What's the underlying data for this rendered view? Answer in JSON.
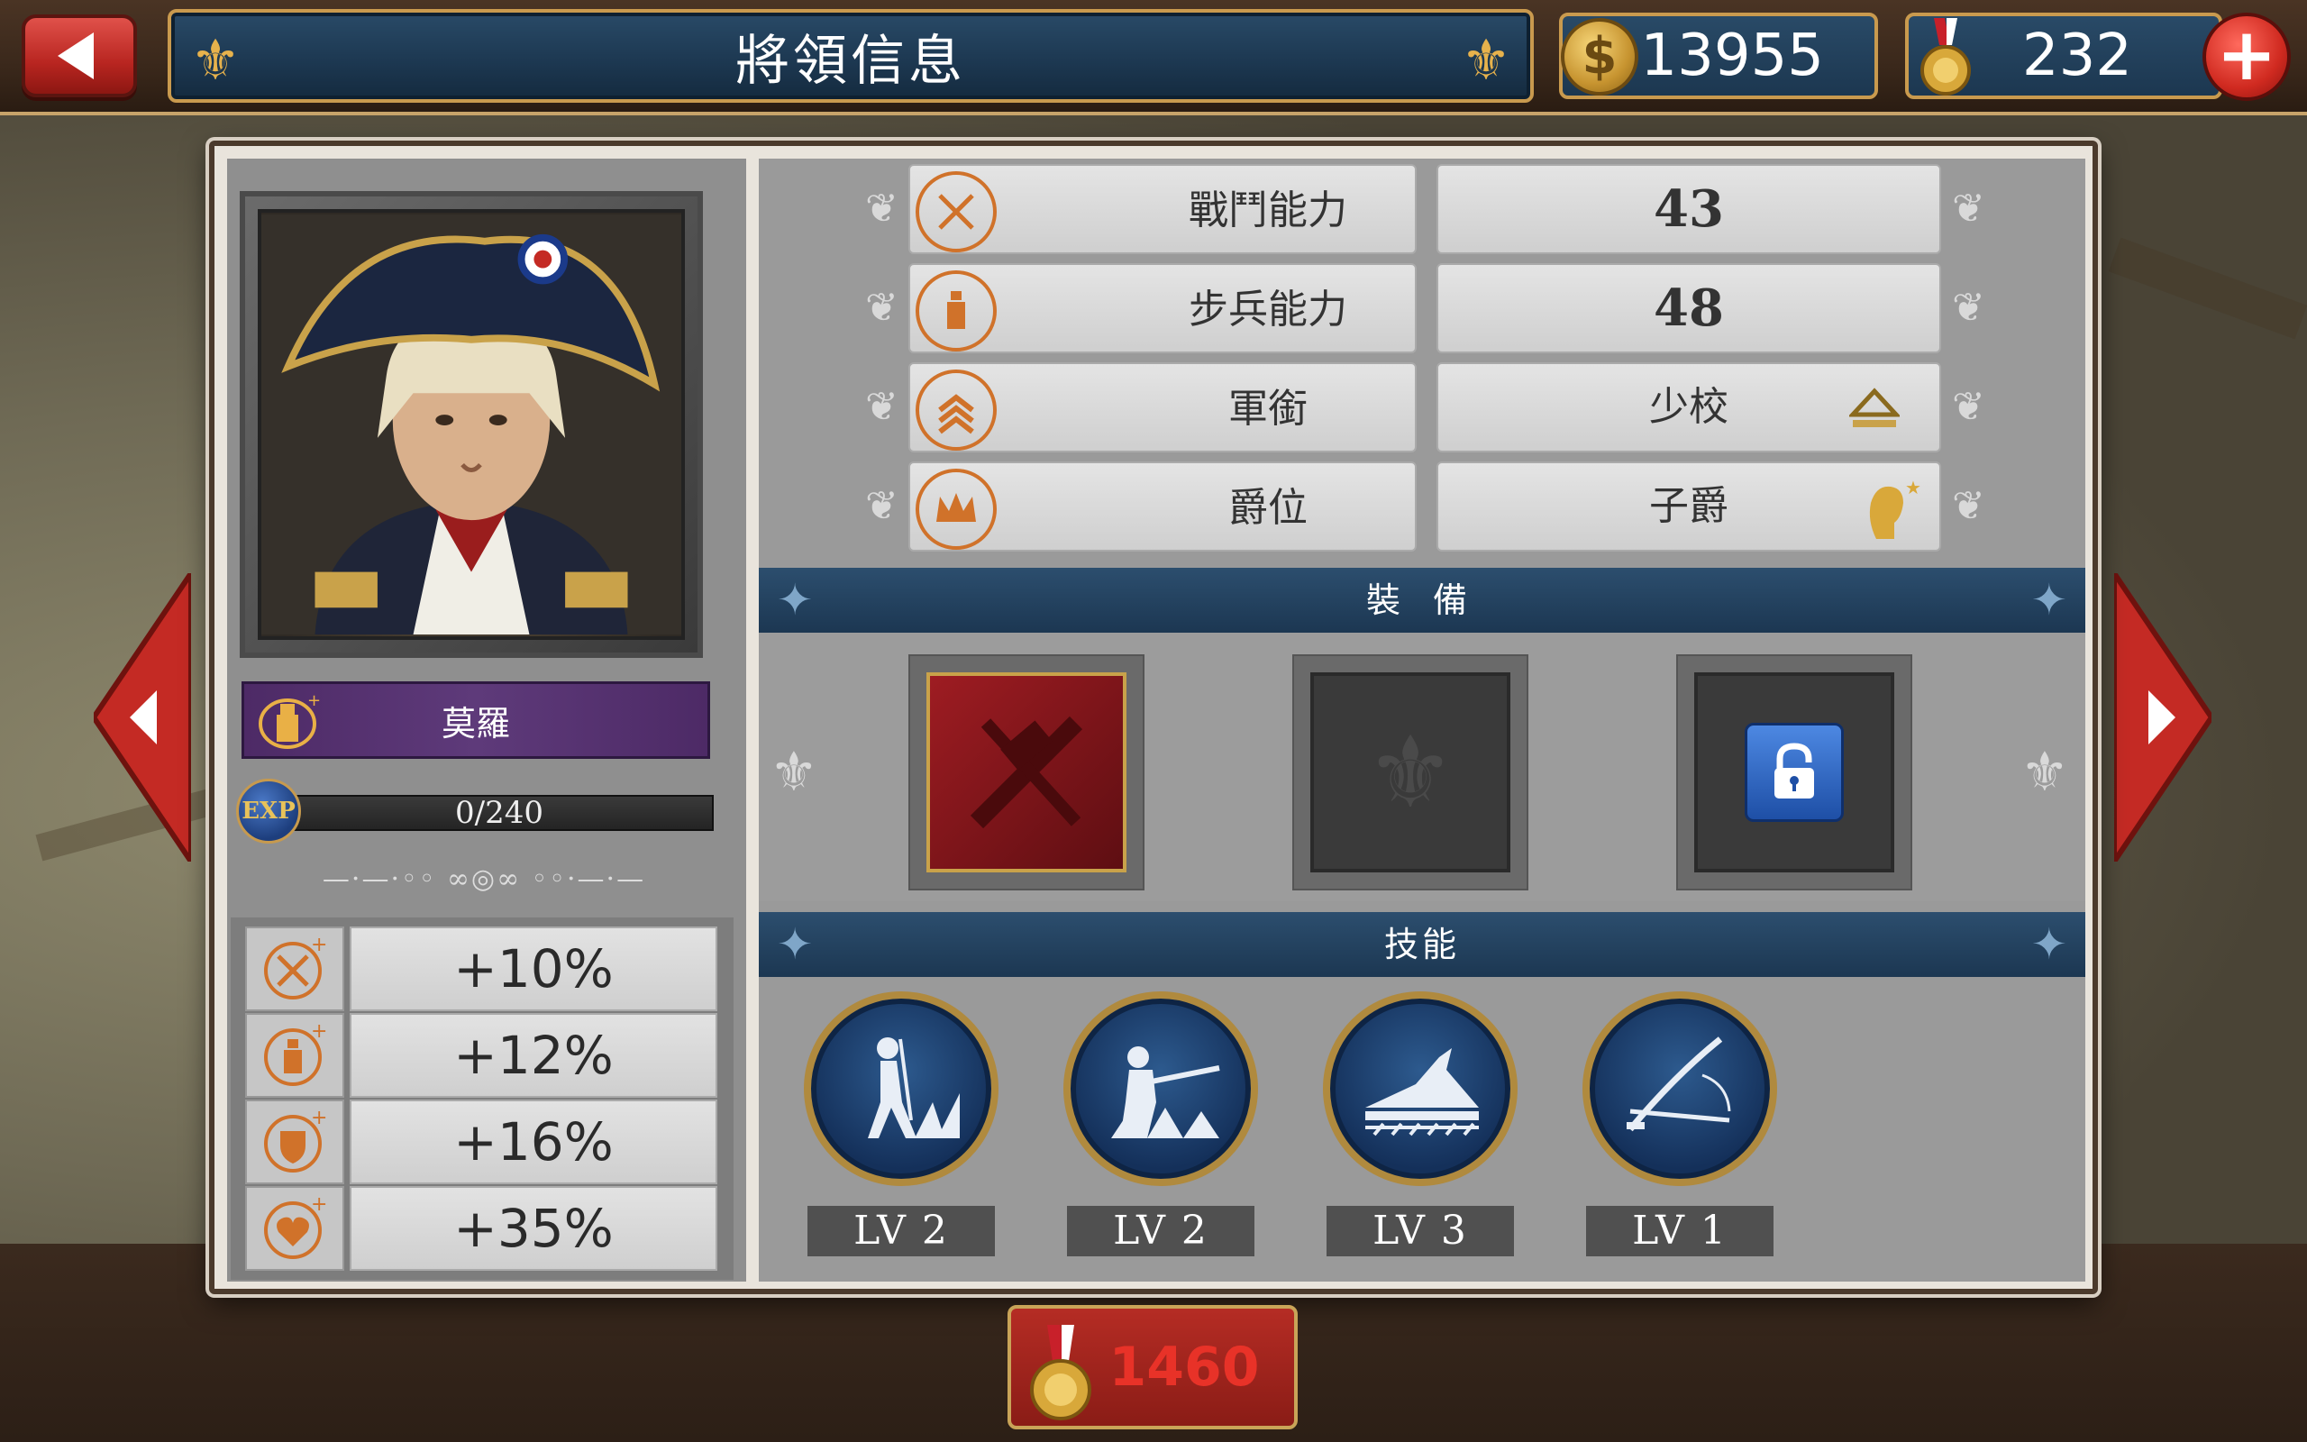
{
  "header": {
    "title": "將領信息",
    "coins": "13955",
    "medals": "232",
    "back_icon": "back-arrow-icon",
    "add_icon": "plus-icon"
  },
  "general": {
    "name": "莫羅",
    "exp": "0/240",
    "exp_badge": "EXP"
  },
  "bonuses": [
    {
      "icon": "sword-plus-icon",
      "value": "+10%"
    },
    {
      "icon": "infantry-plus-icon",
      "value": "+12%"
    },
    {
      "icon": "shield-plus-icon",
      "value": "+16%"
    },
    {
      "icon": "heart-plus-icon",
      "value": "+35%"
    }
  ],
  "stats": [
    {
      "icon": "crossed-swords-icon",
      "label": "戰鬥能力",
      "value": "43"
    },
    {
      "icon": "infantry-icon",
      "label": "步兵能力",
      "value": "48"
    },
    {
      "icon": "rank-chevron-icon",
      "label": "軍銜",
      "value": "少校"
    },
    {
      "icon": "crown-icon",
      "label": "爵位",
      "value": "子爵"
    }
  ],
  "sections": {
    "equipment": "裝 備",
    "skills": "技能"
  },
  "skills": [
    {
      "icon": "march-skill-icon",
      "level": "LV 2"
    },
    {
      "icon": "rifle-skill-icon",
      "level": "LV 2"
    },
    {
      "icon": "fortify-skill-icon",
      "level": "LV 3"
    },
    {
      "icon": "sabre-skill-icon",
      "level": "LV 1"
    }
  ],
  "cost": "1460",
  "colors": {
    "accent_gold": "#c99a4e",
    "header_blue": "#1c3750",
    "button_red": "#b82520",
    "stat_icon_orange": "#d0722a"
  }
}
